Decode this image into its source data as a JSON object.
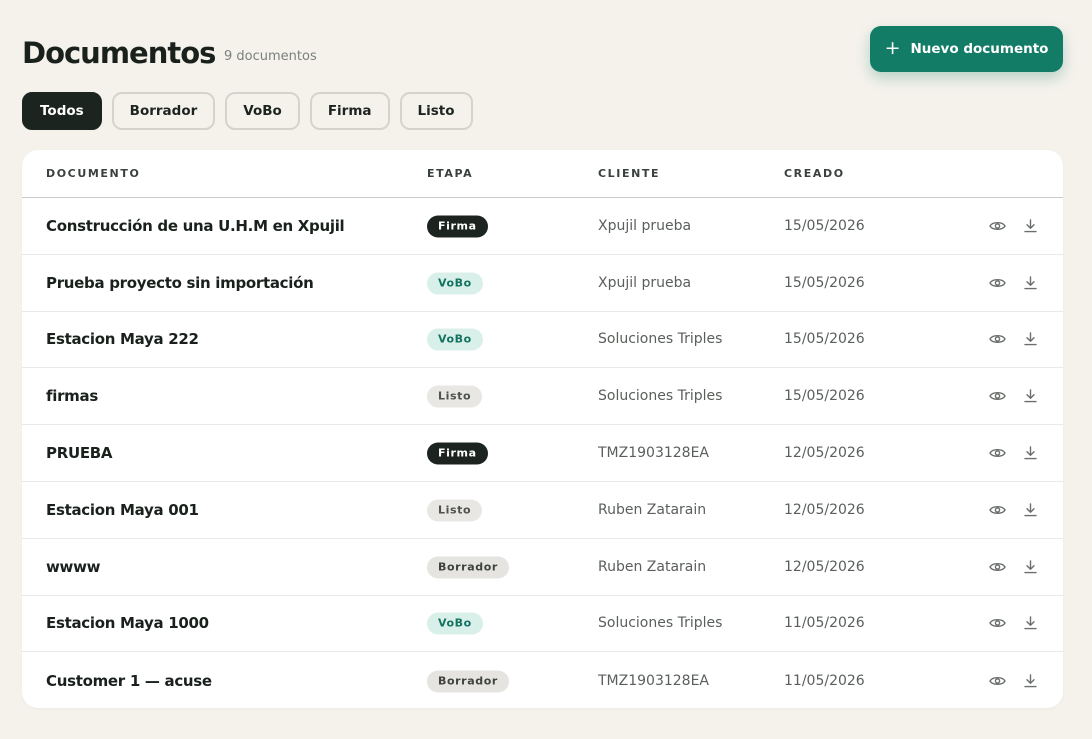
{
  "header": {
    "title": "Documentos",
    "count": "9 documentos",
    "new_button": "Nuevo documento"
  },
  "filters": [
    "Todos",
    "Borrador",
    "VoBo",
    "Firma",
    "Listo"
  ],
  "active_filter": "Todos",
  "table": {
    "columns": [
      "DOCUMENTO",
      "ETAPA",
      "CLIENTE",
      "CREADO"
    ],
    "rows": [
      {
        "name": "Construcción de una U.H.M en Xpujil",
        "stage": "Firma",
        "client": "Xpujil prueba",
        "created": "15/05/2026"
      },
      {
        "name": "Prueba proyecto sin importación",
        "stage": "VoBo",
        "client": "Xpujil prueba",
        "created": "15/05/2026"
      },
      {
        "name": "Estacion Maya 222",
        "stage": "VoBo",
        "client": "Soluciones Triples",
        "created": "15/05/2026"
      },
      {
        "name": "firmas",
        "stage": "Listo",
        "client": "Soluciones Triples",
        "created": "15/05/2026"
      },
      {
        "name": "PRUEBA",
        "stage": "Firma",
        "client": "TMZ1903128EA",
        "created": "12/05/2026"
      },
      {
        "name": "Estacion Maya 001",
        "stage": "Listo",
        "client": "Ruben Zatarain",
        "created": "12/05/2026"
      },
      {
        "name": "wwww",
        "stage": "Borrador",
        "client": "Ruben Zatarain",
        "created": "12/05/2026"
      },
      {
        "name": "Estacion Maya 1000",
        "stage": "VoBo",
        "client": "Soluciones Triples",
        "created": "11/05/2026"
      },
      {
        "name": "Customer 1 — acuse",
        "stage": "Borrador",
        "client": "TMZ1903128EA",
        "created": "11/05/2026"
      }
    ],
    "row_actions": [
      "eye-icon",
      "download-icon"
    ]
  },
  "colors": {
    "background": "#f5f2ec",
    "accent": "#127c66",
    "dark": "#1c2420",
    "vobo_bg": "#d9f0ea",
    "vobo_text": "#137360"
  }
}
